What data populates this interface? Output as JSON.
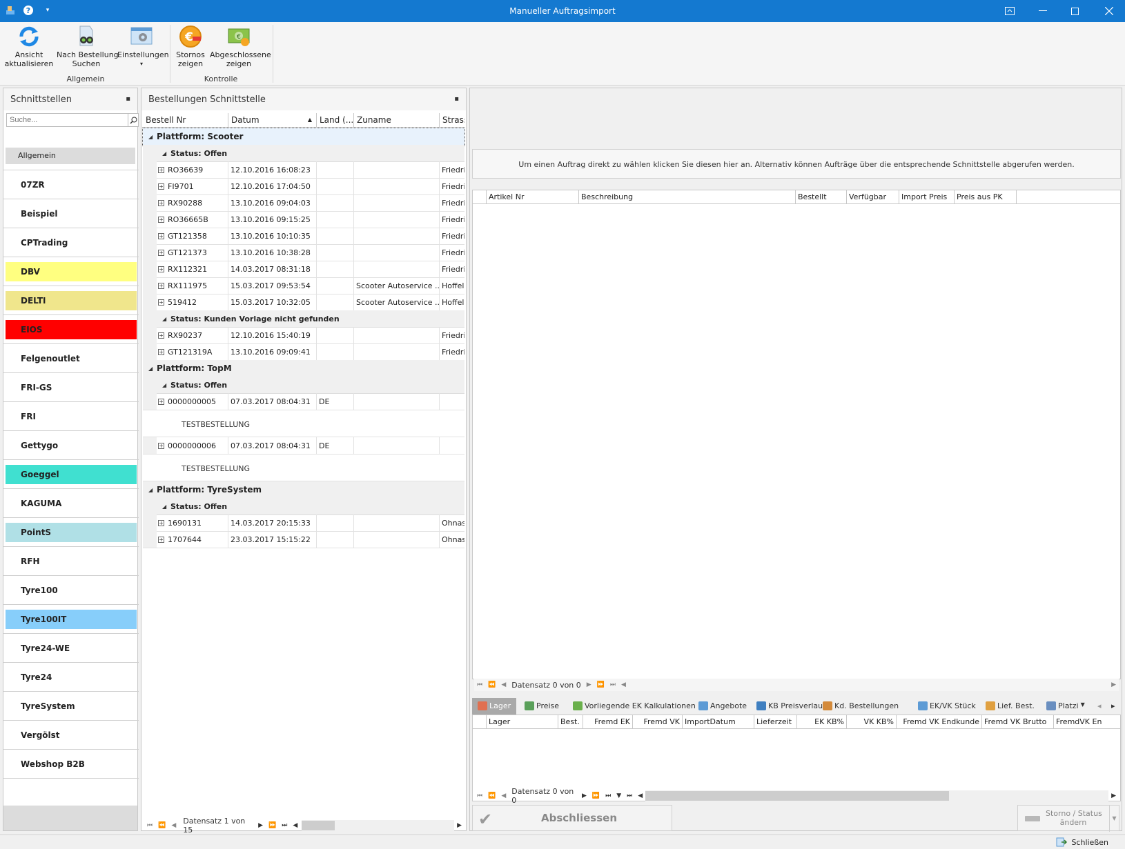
{
  "window": {
    "title": "Manueller Auftragsimport"
  },
  "ribbon": {
    "groups": [
      {
        "label": "Allgemein"
      },
      {
        "label": "Kontrolle"
      }
    ],
    "buttons": [
      {
        "label": "Ansicht\naktualisieren",
        "icon": "refresh-icon"
      },
      {
        "label": "Nach Bestellung\nSuchen",
        "icon": "binoculars-icon"
      },
      {
        "label": "Einstellungen",
        "icon": "settings-window-icon",
        "dropdown": "▾"
      },
      {
        "label": "Stornos\nzeigen",
        "icon": "euro-coin-icon"
      },
      {
        "label": "Abgeschlossene\nzeigen",
        "icon": "money-check-icon"
      }
    ]
  },
  "interfaces": {
    "title": "Schnittstellen",
    "search_placeholder": "Suche...",
    "group": "Allgemein",
    "items": [
      {
        "label": "07ZR",
        "color": ""
      },
      {
        "label": "Beispiel",
        "color": ""
      },
      {
        "label": "CPTrading",
        "color": ""
      },
      {
        "label": "DBV",
        "color": "#ffff80"
      },
      {
        "label": "DELTI",
        "color": "#f0e68c"
      },
      {
        "label": "EIOS",
        "color": "#ff0000"
      },
      {
        "label": "Felgenoutlet",
        "color": ""
      },
      {
        "label": "FRI-GS",
        "color": ""
      },
      {
        "label": "FRI",
        "color": ""
      },
      {
        "label": "Gettygo",
        "color": ""
      },
      {
        "label": "Goeggel",
        "color": "#40e0d0"
      },
      {
        "label": "KAGUMA",
        "color": ""
      },
      {
        "label": "PointS",
        "color": "#b0e0e6"
      },
      {
        "label": "RFH",
        "color": ""
      },
      {
        "label": "Tyre100",
        "color": ""
      },
      {
        "label": "Tyre100IT",
        "color": "#87cefa"
      },
      {
        "label": "Tyre24-WE",
        "color": ""
      },
      {
        "label": "Tyre24",
        "color": ""
      },
      {
        "label": "TyreSystem",
        "color": ""
      },
      {
        "label": "Vergölst",
        "color": ""
      },
      {
        "label": "Webshop B2B",
        "color": ""
      }
    ]
  },
  "orders": {
    "title": "Bestellungen Schnittstelle",
    "columns": [
      "Bestell Nr",
      "Datum",
      "Land (...",
      "Zuname",
      "Strass"
    ],
    "platform_scooter": "Plattform: Scooter",
    "platform_topm": "Plattform: TopM",
    "platform_tyresystem": "Plattform: TyreSystem",
    "status_offen": "Status: Offen",
    "status_kunden": "Status: Kunden Vorlage nicht gefunden",
    "scooter_offen": [
      {
        "nr": "RO36639",
        "datum": "12.10.2016 16:08:23",
        "land": "",
        "zuname": "",
        "strasse": "Friedri"
      },
      {
        "nr": "FI9701",
        "datum": "12.10.2016 17:04:50",
        "land": "",
        "zuname": "",
        "strasse": "Friedri"
      },
      {
        "nr": "RX90288",
        "datum": "13.10.2016 09:04:03",
        "land": "",
        "zuname": "",
        "strasse": "Friedri"
      },
      {
        "nr": "RO36665B",
        "datum": "13.10.2016 09:15:25",
        "land": "",
        "zuname": "",
        "strasse": "Friedri"
      },
      {
        "nr": "GT121358",
        "datum": "13.10.2016 10:10:35",
        "land": "",
        "zuname": "",
        "strasse": "Friedri"
      },
      {
        "nr": "GT121373",
        "datum": "13.10.2016 10:38:28",
        "land": "",
        "zuname": "",
        "strasse": "Friedri"
      },
      {
        "nr": "RX112321",
        "datum": "14.03.2017 08:31:18",
        "land": "",
        "zuname": "",
        "strasse": "Friedri"
      },
      {
        "nr": "RX111975",
        "datum": "15.03.2017 09:53:54",
        "land": "",
        "zuname": "Scooter Autoservice ...",
        "strasse": "Hoffel"
      },
      {
        "nr": "519412",
        "datum": "15.03.2017 10:32:05",
        "land": "",
        "zuname": "Scooter Autoservice ...",
        "strasse": "Hoffel"
      }
    ],
    "scooter_kunden": [
      {
        "nr": "RX90237",
        "datum": "12.10.2016 15:40:19",
        "land": "",
        "zuname": "",
        "strasse": "Friedri"
      },
      {
        "nr": "GT121319A",
        "datum": "13.10.2016 09:09:41",
        "land": "",
        "zuname": "",
        "strasse": "Friedri"
      }
    ],
    "topm_offen": [
      {
        "nr": "0000000005",
        "datum": "07.03.2017 08:04:31",
        "land": "DE",
        "zuname": "",
        "strasse": "",
        "note": "TESTBESTELLUNG"
      },
      {
        "nr": "0000000006",
        "datum": "07.03.2017 08:04:31",
        "land": "DE",
        "zuname": "",
        "strasse": "",
        "note": "TESTBESTELLUNG"
      }
    ],
    "tyresystem_offen": [
      {
        "nr": "1690131",
        "datum": "14.03.2017 20:15:33",
        "land": "",
        "zuname": "",
        "strasse": "Ohnas"
      },
      {
        "nr": "1707644",
        "datum": "23.03.2017 15:15:22",
        "land": "",
        "zuname": "",
        "strasse": "Ohnas"
      }
    ],
    "navigator": "Datensatz 1 von 15"
  },
  "detail": {
    "info": "Um einen Auftrag direkt zu wählen klicken Sie diesen hier an. Alternativ können Aufträge über die entsprechende Schnittstelle abgerufen werden.",
    "article_columns": [
      "Artikel Nr",
      "Beschreibung",
      "Bestellt",
      "Verfügbar",
      "Import Preis",
      "Preis aus PK"
    ],
    "article_navigator": "Datensatz 0 von 0",
    "tabs": [
      "Lager",
      "Preise",
      "Vorliegende EK Kalkulationen",
      "Angebote",
      "KB Preisverlauf",
      "Kd. Bestellungen",
      "EK/VK Stück",
      "Lief. Best.",
      "Platzi"
    ],
    "lager_columns": [
      "Lager",
      "Best.",
      "Fremd EK",
      "Fremd VK",
      "ImportDatum",
      "Lieferzeit",
      "EK KB%",
      "VK KB%",
      "Fremd VK Endkunde",
      "Fremd VK Brutto",
      "FremdVK En"
    ],
    "lager_navigator": "Datensatz 0 von 0",
    "finish_button": "Abschliessen",
    "storno_button": "Storno / Status\nändern"
  },
  "statusbar": {
    "close": "Schließen"
  }
}
